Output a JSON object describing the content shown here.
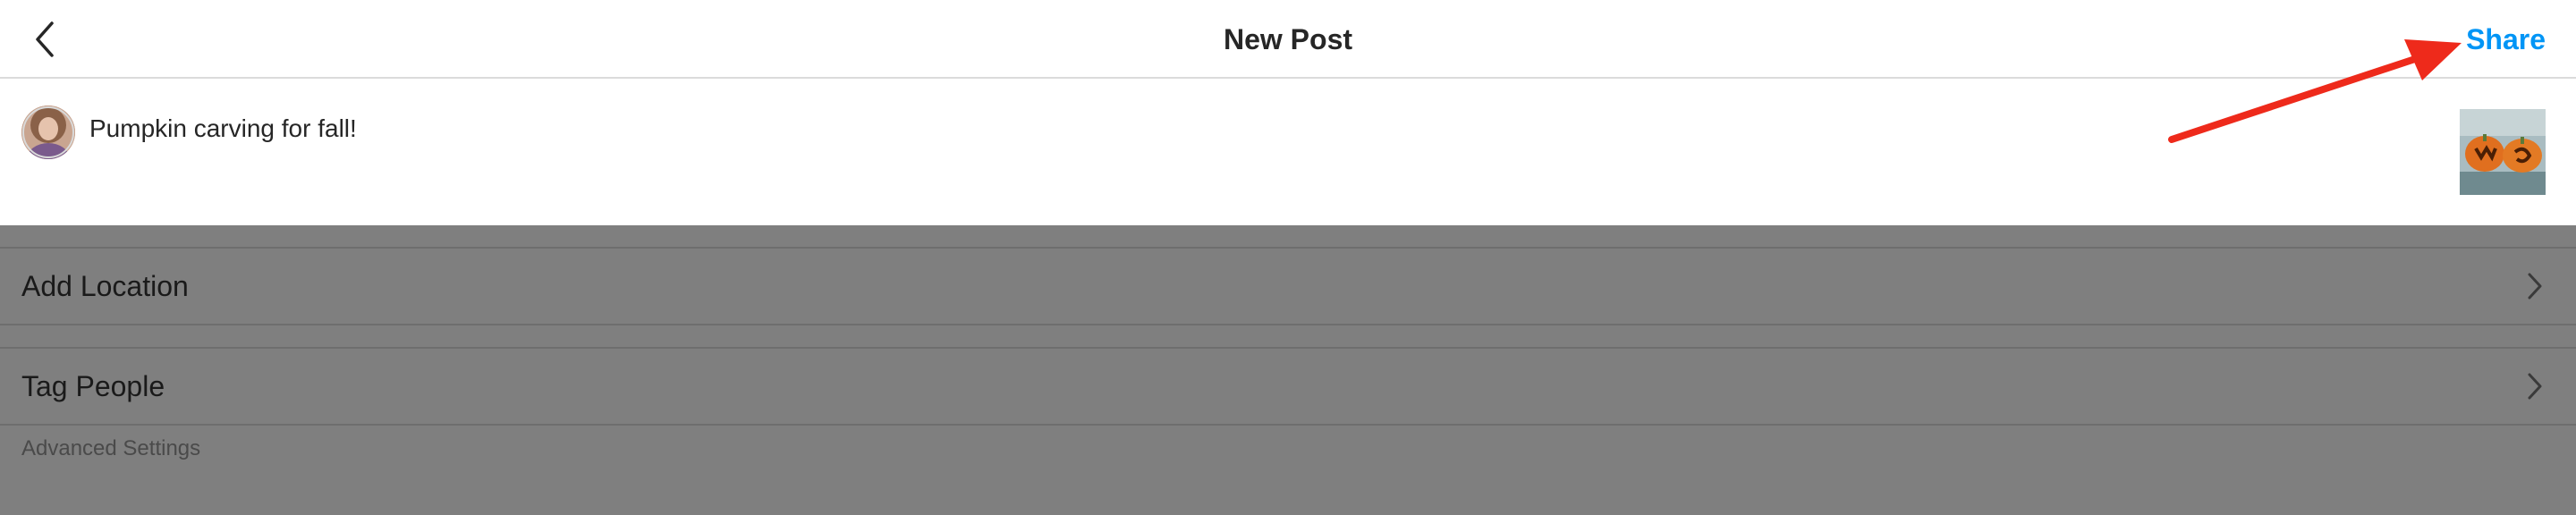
{
  "header": {
    "back_icon": "chevron-left-icon",
    "title": "New Post",
    "share_label": "Share"
  },
  "caption": {
    "text": "Pumpkin carving for fall!",
    "avatar_icon": "user-avatar",
    "thumbnail_icon": "pumpkin-photo-thumbnail"
  },
  "settings": {
    "items": [
      {
        "label": "Add Location",
        "icon": "chevron-right-icon"
      },
      {
        "label": "Tag People",
        "icon": "chevron-right-icon"
      }
    ],
    "advanced_label": "Advanced Settings"
  },
  "colors": {
    "accent": "#0095f6",
    "annotation_arrow": "#ee2a1b",
    "overlay": "#7f7f7f"
  }
}
